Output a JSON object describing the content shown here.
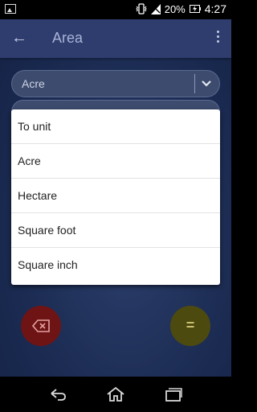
{
  "status": {
    "battery": "20%",
    "time": "4:27"
  },
  "appbar": {
    "title": "Area"
  },
  "from_unit": {
    "value": "Acre"
  },
  "dropdown": {
    "items": [
      "To unit",
      "Acre",
      "Hectare",
      "Square foot",
      "Square inch"
    ]
  },
  "buttons": {
    "equals": "="
  },
  "colors": {
    "appbar": "#2e3d6e",
    "background": "#1b2b52",
    "delete_button": "#6e1414",
    "equals_button": "#4d4a10"
  }
}
